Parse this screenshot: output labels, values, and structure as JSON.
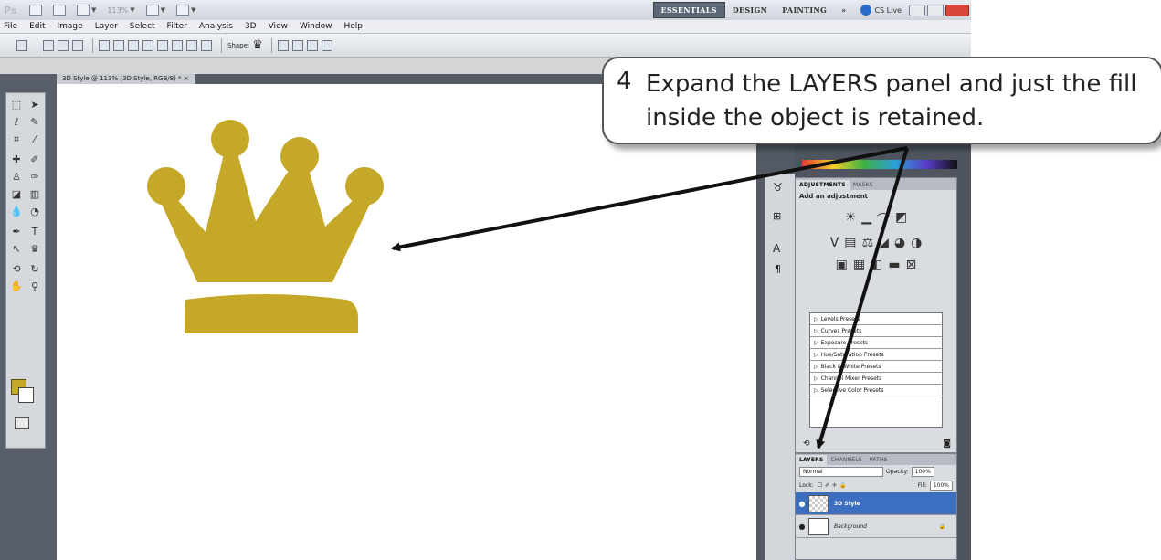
{
  "app": {
    "logo": "Ps",
    "zoom": "113%",
    "workspaces": [
      "ESSENTIALS",
      "DESIGN",
      "PAINTING",
      "»"
    ],
    "cs_live": "CS Live"
  },
  "menu": [
    "File",
    "Edit",
    "Image",
    "Layer",
    "Select",
    "Filter",
    "Analysis",
    "3D",
    "View",
    "Window",
    "Help"
  ],
  "options_bar": {
    "shape_label": "Shape:"
  },
  "document": {
    "tab_title": "3D Style @ 113% (3D Style, RGB/8) * ×"
  },
  "colors": {
    "foreground": "#c6a829",
    "background": "#ffffff",
    "crown": "#c6a829",
    "layer_selected": "#3c6fbf"
  },
  "adjustments": {
    "tabs": [
      "ADJUSTMENTS",
      "MASKS"
    ],
    "title": "Add an adjustment",
    "presets": [
      "Levels Presets",
      "Curves Presets",
      "Exposure Presets",
      "Hue/Saturation Presets",
      "Black & White Presets",
      "Channel Mixer Presets",
      "Selective Color Presets"
    ]
  },
  "layers": {
    "tabs": [
      "LAYERS",
      "CHANNELS",
      "PATHS"
    ],
    "blend_mode": "Normal",
    "opacity_label": "Opacity:",
    "opacity": "100%",
    "lock_label": "Lock:",
    "fill_label": "Fill:",
    "fill": "100%",
    "items": [
      {
        "name": "3D Style",
        "selected": true
      },
      {
        "name": "Background",
        "selected": false
      }
    ]
  },
  "callout": {
    "number": "4",
    "text": "Expand the LAYERS panel and just the fill inside the object is retained."
  }
}
